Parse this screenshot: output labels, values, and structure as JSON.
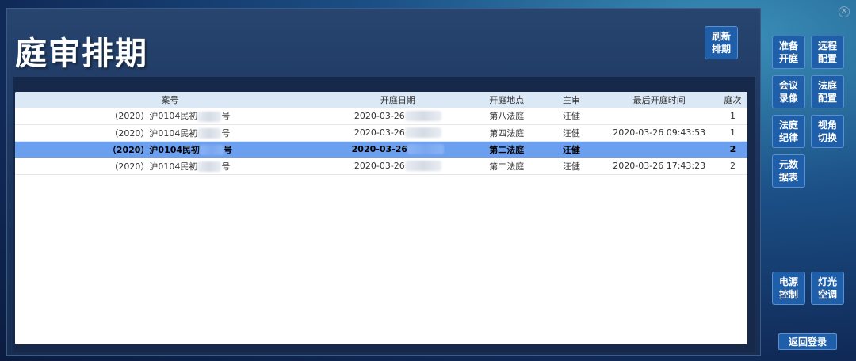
{
  "header": {
    "title": "庭审排期",
    "refresh_label": "刷新排期"
  },
  "table": {
    "columns": [
      "案号",
      "开庭日期",
      "开庭地点",
      "主审",
      "最后开庭时间",
      "庭次"
    ],
    "rows": [
      {
        "case_prefix": "（2020）沪0104民初",
        "case_suffix": "号",
        "date": "2020-03-26",
        "location": "第八法庭",
        "judge": "汪健",
        "last_time": "",
        "times": "1",
        "selected": false
      },
      {
        "case_prefix": "（2020）沪0104民初",
        "case_suffix": "号",
        "date": "2020-03-26",
        "location": "第四法庭",
        "judge": "汪健",
        "last_time": "2020-03-26 09:43:53",
        "times": "1",
        "selected": false
      },
      {
        "case_prefix": "（2020）沪0104民初",
        "case_suffix": "号",
        "date": "2020-03-26",
        "location": "第二法庭",
        "judge": "汪健",
        "last_time": "",
        "times": "2",
        "selected": true
      },
      {
        "case_prefix": "（2020）沪0104民初",
        "case_suffix": "号",
        "date": "2020-03-26",
        "location": "第二法庭",
        "judge": "汪健",
        "last_time": "2020-03-26 17:43:23",
        "times": "2",
        "selected": false
      }
    ]
  },
  "sidebar": {
    "buttons": [
      {
        "label": "准备开庭",
        "name": "prepare-hearing-button"
      },
      {
        "label": "远程配置",
        "name": "remote-config-button"
      },
      {
        "label": "会议录像",
        "name": "meeting-recording-button"
      },
      {
        "label": "法庭配置",
        "name": "court-config-button"
      },
      {
        "label": "法庭纪律",
        "name": "court-discipline-button"
      },
      {
        "label": "视角切换",
        "name": "view-switch-button"
      },
      {
        "label": "元数据表",
        "name": "metadata-table-button"
      },
      {
        "label": "电源控制",
        "name": "power-control-button"
      },
      {
        "label": "灯光空调",
        "name": "lights-ac-button"
      }
    ],
    "back_label": "返回登录"
  },
  "icons": {
    "close": "close-icon"
  },
  "colors": {
    "accent": "#1f5ea8",
    "selected_row": "#6b9ff0",
    "header_row": "#dbe8f6",
    "panel": "#1c3660"
  }
}
